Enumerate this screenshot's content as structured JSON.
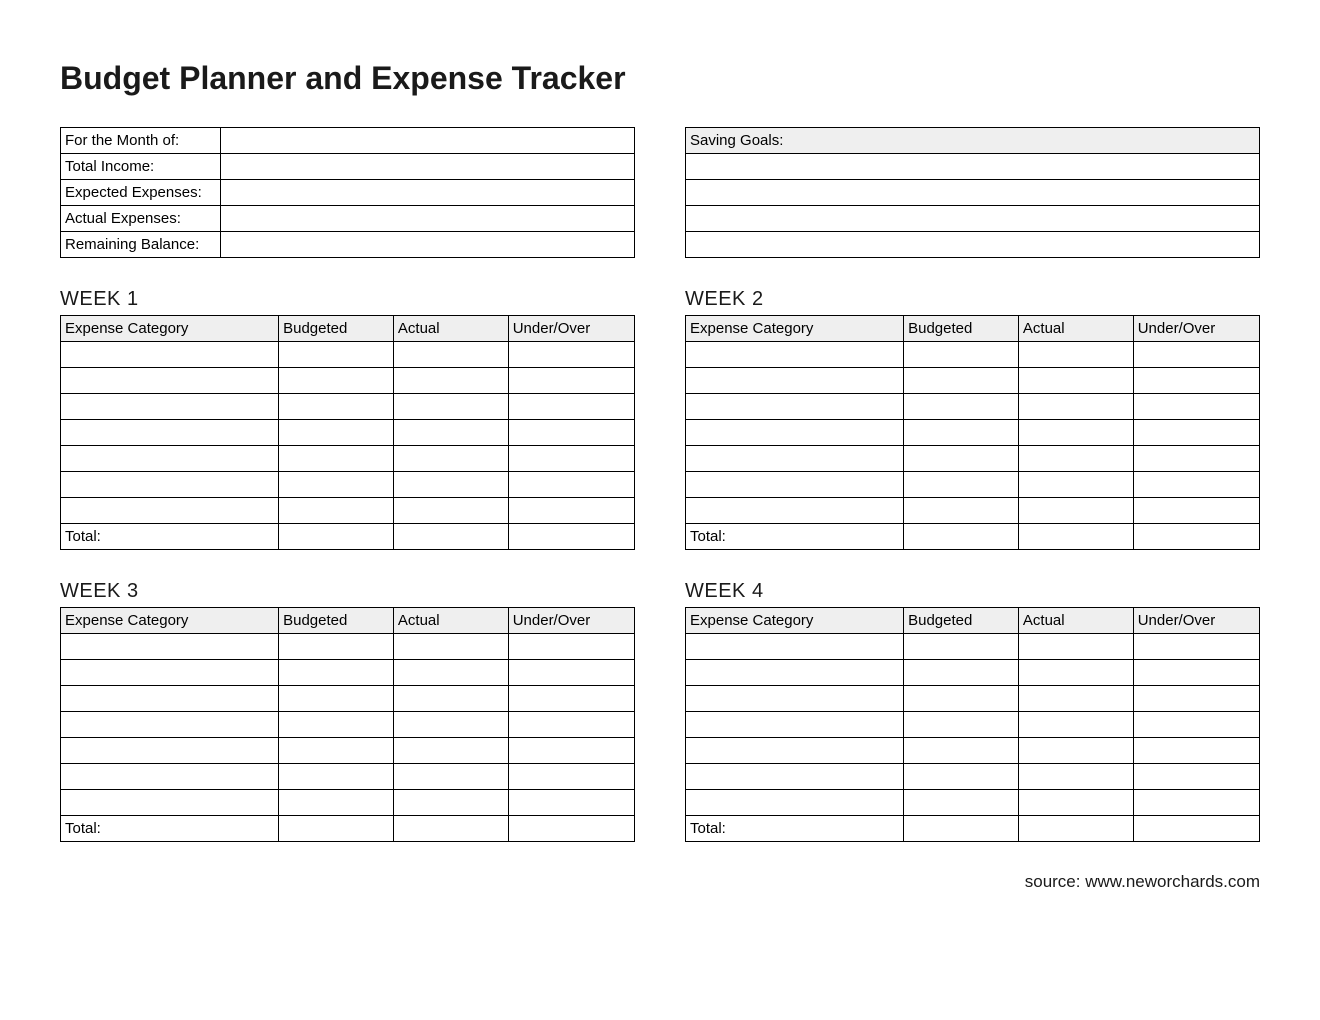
{
  "title": "Budget Planner and Expense Tracker",
  "summary": {
    "rows": [
      {
        "label": "For the Month of:",
        "value": ""
      },
      {
        "label": "Total Income:",
        "value": ""
      },
      {
        "label": "Expected Expenses:",
        "value": ""
      },
      {
        "label": "Actual Expenses:",
        "value": ""
      },
      {
        "label": "Remaining Balance:",
        "value": ""
      }
    ]
  },
  "goals": {
    "header": "Saving Goals:",
    "rows": [
      "",
      "",
      "",
      ""
    ]
  },
  "week_columns": [
    "Expense Category",
    "Budgeted",
    "Actual",
    "Under/Over"
  ],
  "weeks": [
    {
      "title": "WEEK 1",
      "rows": [
        [
          "",
          "",
          "",
          ""
        ],
        [
          "",
          "",
          "",
          ""
        ],
        [
          "",
          "",
          "",
          ""
        ],
        [
          "",
          "",
          "",
          ""
        ],
        [
          "",
          "",
          "",
          ""
        ],
        [
          "",
          "",
          "",
          ""
        ],
        [
          "",
          "",
          "",
          ""
        ]
      ],
      "total_label": "Total:",
      "total": [
        "",
        "",
        ""
      ]
    },
    {
      "title": "WEEK 2",
      "rows": [
        [
          "",
          "",
          "",
          ""
        ],
        [
          "",
          "",
          "",
          ""
        ],
        [
          "",
          "",
          "",
          ""
        ],
        [
          "",
          "",
          "",
          ""
        ],
        [
          "",
          "",
          "",
          ""
        ],
        [
          "",
          "",
          "",
          ""
        ],
        [
          "",
          "",
          "",
          ""
        ]
      ],
      "total_label": "Total:",
      "total": [
        "",
        "",
        ""
      ]
    },
    {
      "title": "WEEK 3",
      "rows": [
        [
          "",
          "",
          "",
          ""
        ],
        [
          "",
          "",
          "",
          ""
        ],
        [
          "",
          "",
          "",
          ""
        ],
        [
          "",
          "",
          "",
          ""
        ],
        [
          "",
          "",
          "",
          ""
        ],
        [
          "",
          "",
          "",
          ""
        ],
        [
          "",
          "",
          "",
          ""
        ]
      ],
      "total_label": "Total:",
      "total": [
        "",
        "",
        ""
      ]
    },
    {
      "title": "WEEK 4",
      "rows": [
        [
          "",
          "",
          "",
          ""
        ],
        [
          "",
          "",
          "",
          ""
        ],
        [
          "",
          "",
          "",
          ""
        ],
        [
          "",
          "",
          "",
          ""
        ],
        [
          "",
          "",
          "",
          ""
        ],
        [
          "",
          "",
          "",
          ""
        ],
        [
          "",
          "",
          "",
          ""
        ]
      ],
      "total_label": "Total:",
      "total": [
        "",
        "",
        ""
      ]
    }
  ],
  "source": "source: www.neworchards.com"
}
